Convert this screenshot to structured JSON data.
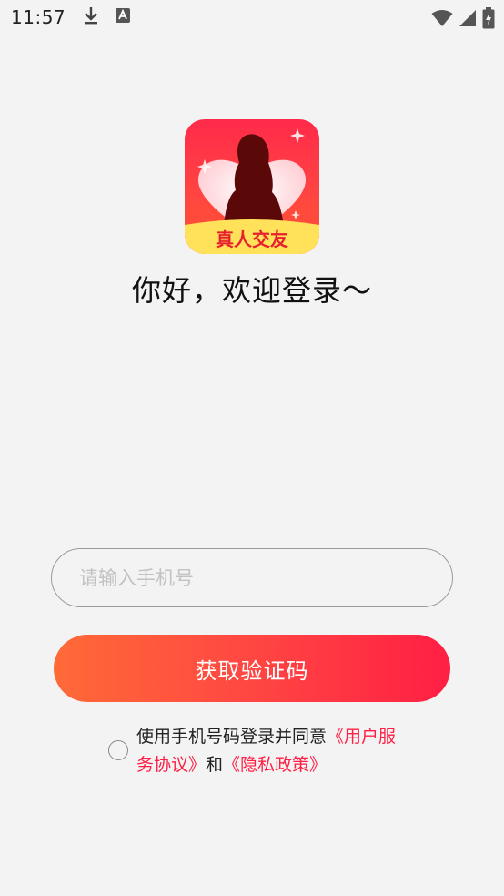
{
  "status_bar": {
    "time": "11:57",
    "left_icons": [
      "download-icon",
      "text-a-icon"
    ],
    "right_icons": [
      "wifi-icon",
      "signal-icon",
      "battery-icon"
    ]
  },
  "logo": {
    "badge_text": "真人交友",
    "colors": {
      "bg_top": "#ff2a4a",
      "bg_bottom": "#ff5a3a",
      "heart": "#ffe3e3",
      "silhouette": "#5a0808",
      "ribbon": "#ffe15a",
      "ribbon_text": "#e6202f"
    }
  },
  "welcome": {
    "title": "你好，欢迎登录～"
  },
  "login": {
    "phone_placeholder": "请输入手机号",
    "phone_value": "",
    "get_code_label": "获取验证码"
  },
  "agreement": {
    "prefix": "使用手机号码登录并同意",
    "user_agreement": "《用户服务协议》",
    "and": "和",
    "privacy_policy": "《隐私政策》",
    "checked": false
  },
  "colors": {
    "accent": "#ff1f44",
    "gradient_start": "#ff6a37",
    "background": "#f3f3f3"
  }
}
